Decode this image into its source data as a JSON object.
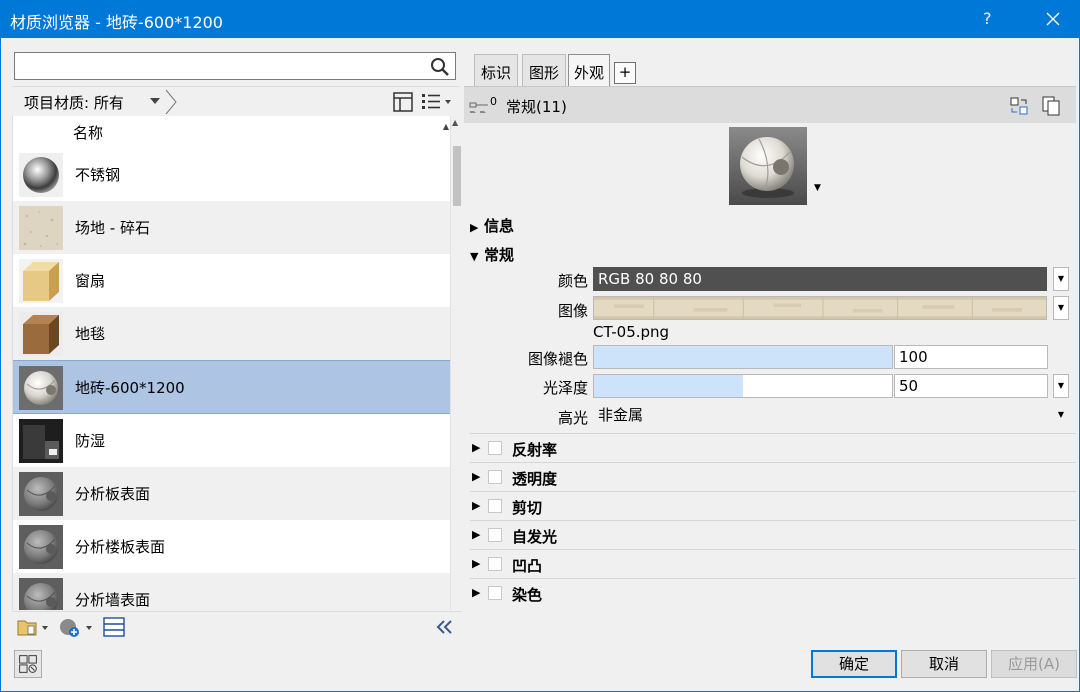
{
  "window": {
    "title": "材质浏览器 - 地砖-600*1200",
    "help": "?"
  },
  "left": {
    "search": {
      "value": "",
      "placeholder": ""
    },
    "filter_label": "项目材质: 所有",
    "column_header": "名称",
    "materials": [
      {
        "label": "不锈钢",
        "thumb": "chrome-sphere"
      },
      {
        "label": "场地 - 碎石",
        "thumb": "gravel-texture"
      },
      {
        "label": "窗扇",
        "thumb": "wood-cube"
      },
      {
        "label": "地毯",
        "thumb": "carpet-cube"
      },
      {
        "label": "地砖-600*1200",
        "thumb": "tile-sphere",
        "selected": true
      },
      {
        "label": "防湿",
        "thumb": "dark-membrane"
      },
      {
        "label": "分析板表面",
        "thumb": "analysis-sphere"
      },
      {
        "label": "分析楼板表面",
        "thumb": "analysis-sphere"
      },
      {
        "label": "分析墙表面",
        "thumb": "analysis-sphere"
      }
    ]
  },
  "right": {
    "tabs": [
      {
        "label": "标识",
        "active": false
      },
      {
        "label": "图形",
        "active": false
      },
      {
        "label": "外观",
        "active": true
      }
    ],
    "tab_add": "+",
    "asset_count_badge": "0",
    "asset_name": "常规(11)",
    "section_info": "信息",
    "section_general": "常规",
    "props": {
      "color_label": "颜色",
      "color_value": "RGB 80 80 80",
      "image_label": "图像",
      "image_file": "CT-05.png",
      "fade_label": "图像褪色",
      "fade_value": "100",
      "fade_fraction": 1.0,
      "gloss_label": "光泽度",
      "gloss_value": "50",
      "gloss_fraction": 0.5,
      "highlight_label": "高光",
      "highlight_value": "非金属"
    },
    "optional_sections": [
      "反射率",
      "透明度",
      "剪切",
      "自发光",
      "凹凸",
      "染色"
    ]
  },
  "buttons": {
    "ok": "确定",
    "cancel": "取消",
    "apply": "应用(A)"
  },
  "colors": {
    "titlebar": "#0078d7",
    "selection": "#aec4e3",
    "color_swatch": "#505050",
    "slider_fill": "#cce3f9"
  }
}
